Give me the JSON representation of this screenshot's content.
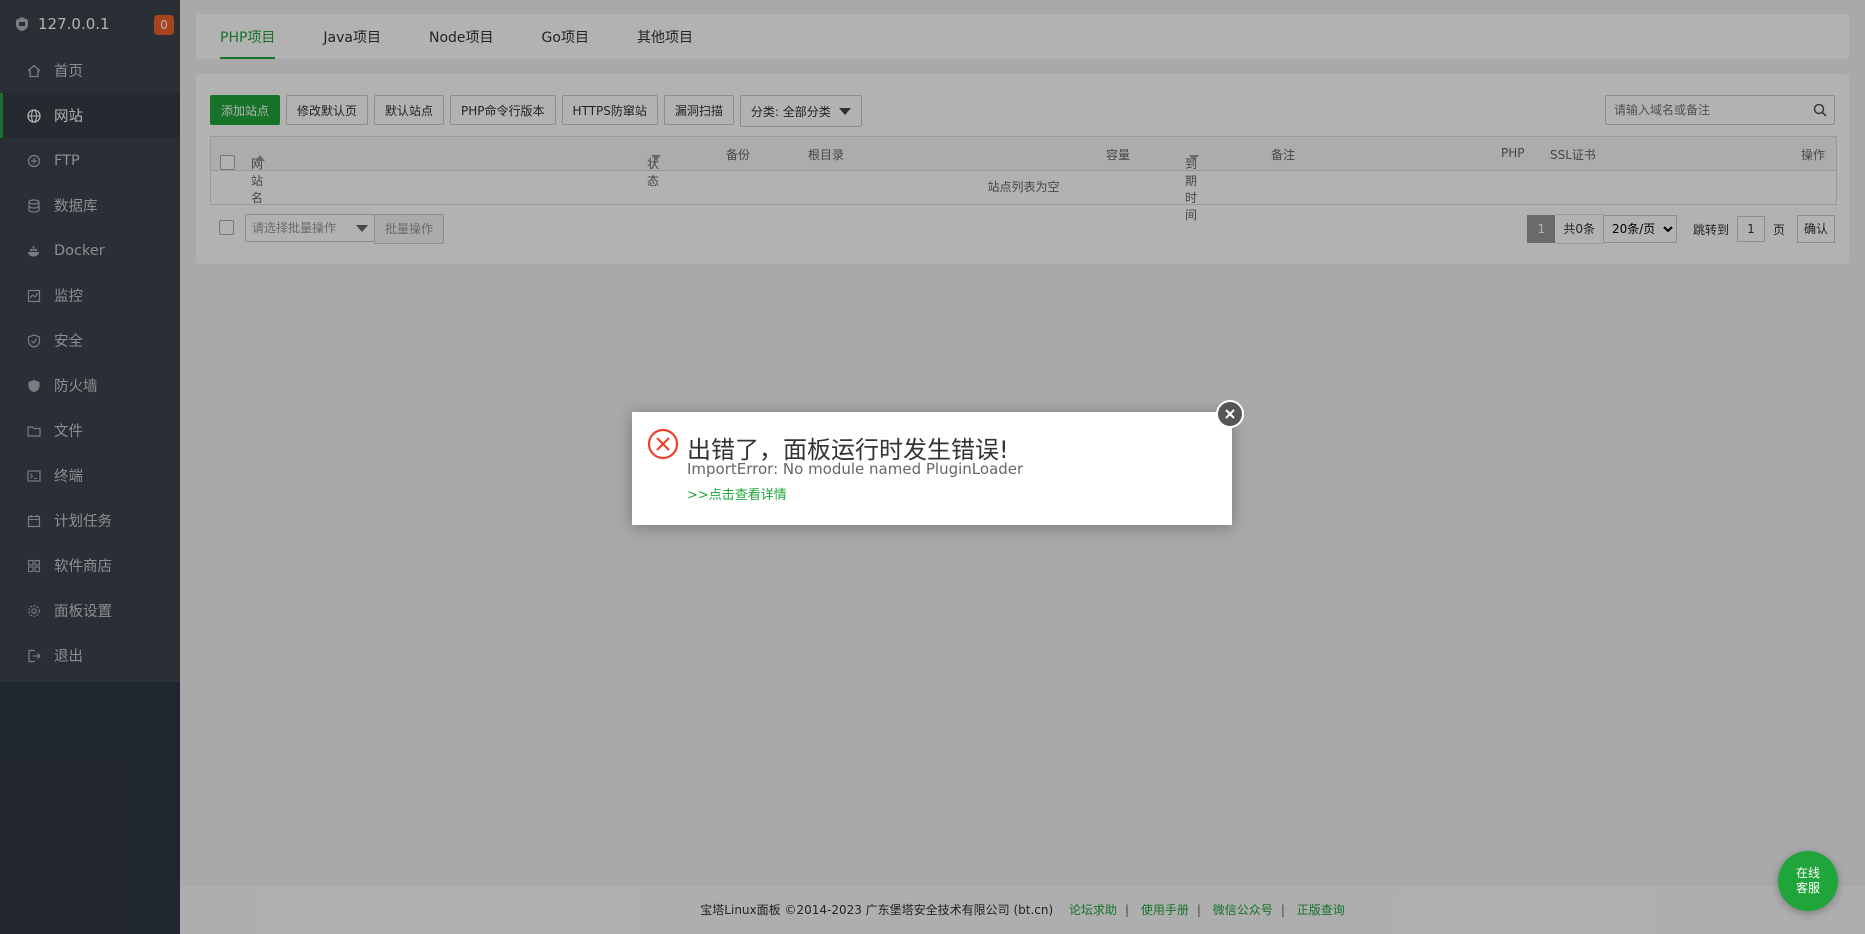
{
  "sidebar": {
    "host": "127.0.0.1",
    "badge": "0",
    "items": [
      {
        "label": "首页",
        "icon": "home-icon"
      },
      {
        "label": "网站",
        "icon": "globe-icon"
      },
      {
        "label": "FTP",
        "icon": "ftp-icon"
      },
      {
        "label": "数据库",
        "icon": "database-icon"
      },
      {
        "label": "Docker",
        "icon": "docker-icon"
      },
      {
        "label": "监控",
        "icon": "monitor-icon"
      },
      {
        "label": "安全",
        "icon": "shield-icon"
      },
      {
        "label": "防火墙",
        "icon": "firewall-icon"
      },
      {
        "label": "文件",
        "icon": "folder-icon"
      },
      {
        "label": "终端",
        "icon": "terminal-icon"
      },
      {
        "label": "计划任务",
        "icon": "calendar-icon"
      },
      {
        "label": "软件商店",
        "icon": "grid-icon"
      },
      {
        "label": "面板设置",
        "icon": "gear-icon"
      },
      {
        "label": "退出",
        "icon": "logout-icon"
      }
    ]
  },
  "tabs": [
    "PHP项目",
    "Java项目",
    "Node项目",
    "Go项目",
    "其他项目"
  ],
  "toolbar": {
    "add_site": "添加站点",
    "edit_default": "修改默认页",
    "default_site": "默认站点",
    "php_cli": "PHP命令行版本",
    "https_protect": "HTTPS防窜站",
    "vuln_scan": "漏洞扫描",
    "category": "分类: 全部分类",
    "search_placeholder": "请输入域名或备注"
  },
  "table": {
    "headers": {
      "name": "网站名",
      "status": "状态",
      "backup": "备份",
      "root": "根目录",
      "capacity": "容量",
      "expire": "到期时间",
      "remark": "备注",
      "php": "PHP",
      "ssl": "SSL证书",
      "ops": "操作"
    },
    "empty": "站点列表为空"
  },
  "batch": {
    "placeholder": "请选择批量操作",
    "button": "批量操作"
  },
  "pager": {
    "current": "1",
    "total": "共0条",
    "page_size": "20条/页",
    "jump_label": "跳转到",
    "jump_value": "1",
    "page_unit": "页",
    "confirm": "确认"
  },
  "footer": {
    "copyright": "宝塔Linux面板 ©2014-2023 广东堡塔安全技术有限公司 (bt.cn)",
    "links": [
      "论坛求助",
      "使用手册",
      "微信公众号",
      "正版查询"
    ]
  },
  "dialog": {
    "title": "出错了，面板运行时发生错误!",
    "message": "ImportError: No module named PluginLoader",
    "detail_link": ">>点击查看详情"
  },
  "chat": {
    "line1": "在线",
    "line2": "客服"
  },
  "colors": {
    "accent": "#20a53a",
    "sidebar": "#3c444d",
    "error": "#e8462b",
    "badge": "#f0622b"
  }
}
